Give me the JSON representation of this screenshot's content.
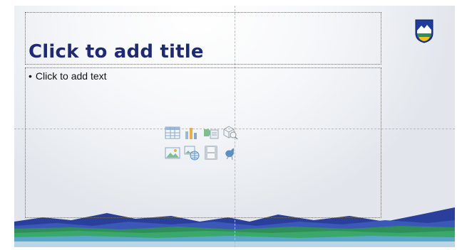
{
  "slide": {
    "title_placeholder": "Click to add title",
    "body_bullet": "•",
    "body_placeholder": "Click to add text",
    "colors": {
      "title": "#1f2a73",
      "accent_blue": "#2a3f9c",
      "accent_green": "#2f8f5a"
    },
    "insert_icons": [
      "insert-table-icon",
      "insert-chart-icon",
      "insert-smartart-icon",
      "insert-3d-model-icon",
      "insert-picture-icon",
      "insert-online-picture-icon",
      "insert-video-icon",
      "insert-icons-icon"
    ]
  }
}
